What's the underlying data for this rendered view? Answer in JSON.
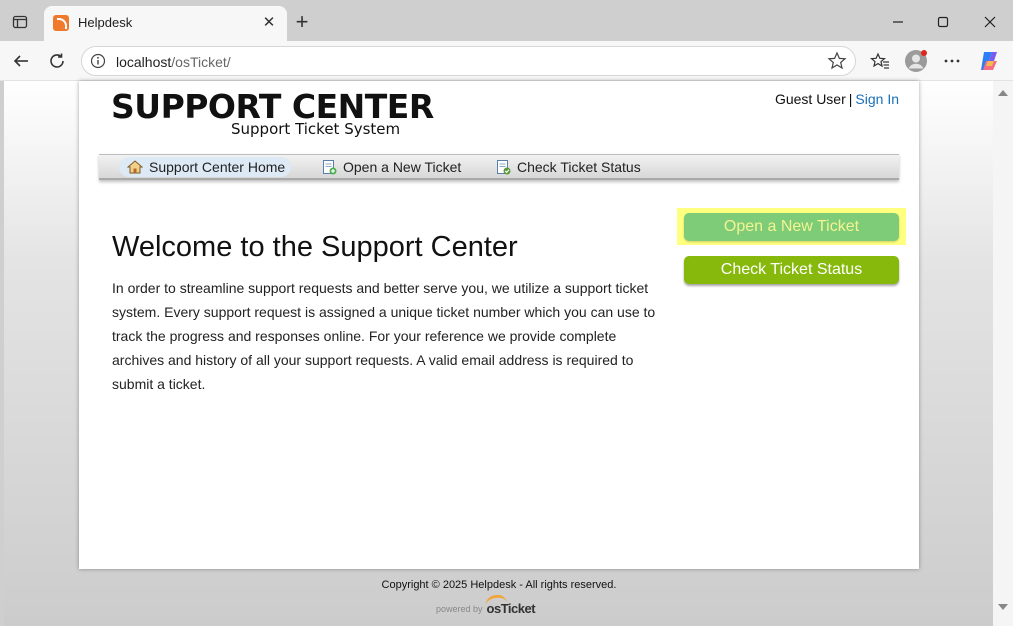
{
  "browser": {
    "tab_title": "Helpdesk",
    "address_host": "localhost",
    "address_path": "/osTicket/",
    "icons": [
      "sidebar-toggle-icon",
      "close-icon",
      "plus-icon",
      "minimize-icon",
      "maximize-icon",
      "close-window-icon",
      "back-arrow-icon",
      "refresh-icon",
      "info-icon",
      "star-icon",
      "favorites-icon",
      "profile-icon",
      "more-icon",
      "copilot-icon"
    ]
  },
  "header": {
    "logo_main": "SUPPORT CENTER",
    "logo_sub": "Support Ticket System",
    "guest_label": "Guest User",
    "separator": "|",
    "sign_in": "Sign In"
  },
  "nav": {
    "items": [
      {
        "label": "Support Center Home",
        "icon": "home-icon",
        "active": true
      },
      {
        "label": "Open a New Ticket",
        "icon": "new-ticket-icon",
        "active": false
      },
      {
        "label": "Check Ticket Status",
        "icon": "ticket-status-icon",
        "active": false
      }
    ]
  },
  "main": {
    "heading": "Welcome to the Support Center",
    "intro": "In order to streamline support requests and better serve you, we utilize a support ticket system. Every support request is assigned a unique ticket number which you can use to track the progress and responses online. For your reference we provide complete archives and history of all your support requests. A valid email address is required to submit a ticket."
  },
  "actions": {
    "open_ticket": "Open a New Ticket",
    "check_status": "Check Ticket Status"
  },
  "footer": {
    "copyright": "Copyright © 2025 Helpdesk - All rights reserved.",
    "powered_by": "powered by",
    "brand": "osTicket"
  },
  "colors": {
    "link": "#1a6fb8",
    "open_button": "#7ecb78",
    "check_button": "#86b90b",
    "highlight": "#ffff80"
  }
}
